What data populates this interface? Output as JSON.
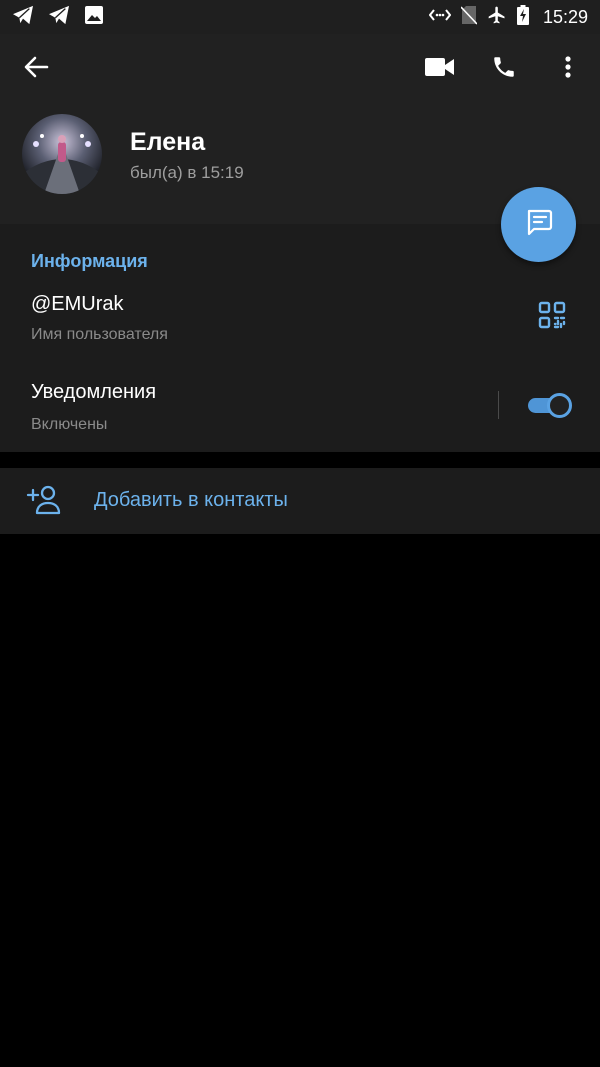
{
  "status_bar": {
    "time": "15:29",
    "left_icons": [
      "telegram-icon",
      "telegram-icon",
      "image-icon"
    ],
    "right_icons": [
      "data-saver-icon",
      "no-sim-icon",
      "airplane-icon",
      "battery-charging-icon"
    ]
  },
  "app_bar": {
    "back_icon": "arrow-left-icon",
    "actions": [
      "video-call-icon",
      "phone-icon",
      "more-vert-icon"
    ]
  },
  "profile": {
    "name": "Елена",
    "last_seen": "был(а) в 15:19"
  },
  "fab": {
    "icon": "message-icon",
    "color": "#5aa2e3"
  },
  "info": {
    "title": "Информация",
    "username": "@EMUrak",
    "username_label": "Имя пользователя",
    "notifications_title": "Уведомления",
    "notifications_value": "Включены",
    "notifications_enabled": true
  },
  "add_contact": {
    "label": "Добавить в контакты"
  },
  "colors": {
    "accent": "#6cb2ec",
    "background": "#000000",
    "surface": "#1c1c1c",
    "header": "#212121"
  }
}
